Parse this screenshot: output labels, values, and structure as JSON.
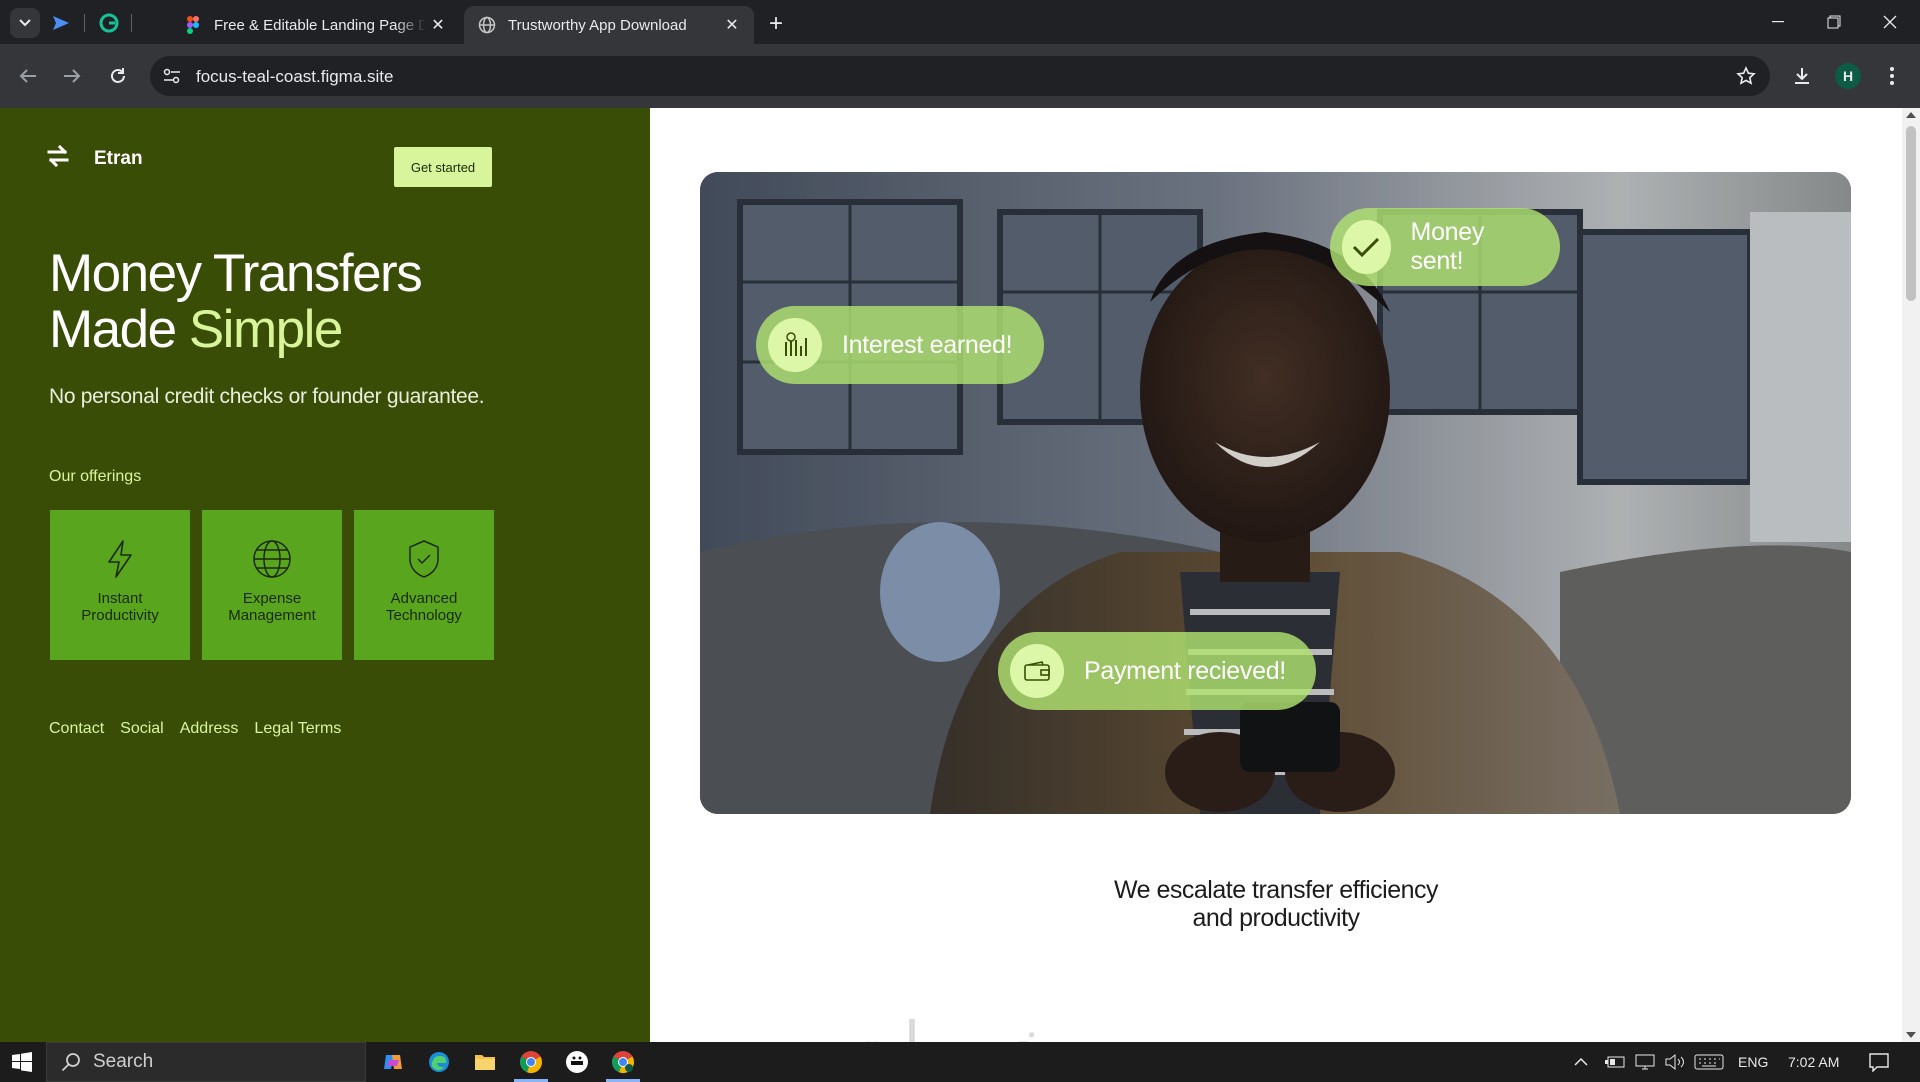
{
  "browser": {
    "tabs": [
      {
        "title": "Free & Editable Landing Page Design",
        "active": false
      },
      {
        "title": "Trustworthy App Download",
        "active": true
      }
    ],
    "url": "focus-teal-coast.figma.site",
    "profile_initial": "H"
  },
  "page": {
    "brand": "Etran",
    "cta_label": "Get started",
    "headline_line1": "Money Transfers",
    "headline_line2_prefix": "Made",
    "headline_accent": "Simple",
    "subheadline": "No personal credit checks or founder guarantee.",
    "offerings_label": "Our offerings",
    "offerings": [
      {
        "label": "Instant Productivity",
        "icon": "lightning-icon"
      },
      {
        "label": "Expense Management",
        "icon": "globe-icon"
      },
      {
        "label": "Advanced Technology",
        "icon": "shield-check-icon"
      }
    ],
    "footer_links": [
      "Contact",
      "Social",
      "Address",
      "Legal Terms"
    ],
    "notifications": {
      "money_sent": "Money sent!",
      "interest_earned": "Interest earned!",
      "payment_received": "Payment recieved!"
    },
    "tagline_line1": "We escalate transfer efficiency",
    "tagline_line2": "and productivity",
    "watermark": "خمسات"
  },
  "taskbar": {
    "search_placeholder": "Search",
    "language": "ENG",
    "time": "7:02 AM"
  },
  "colors": {
    "panel_green": "#3a4d07",
    "accent_lime": "#d8f59c",
    "card_green": "#5aa51e"
  }
}
